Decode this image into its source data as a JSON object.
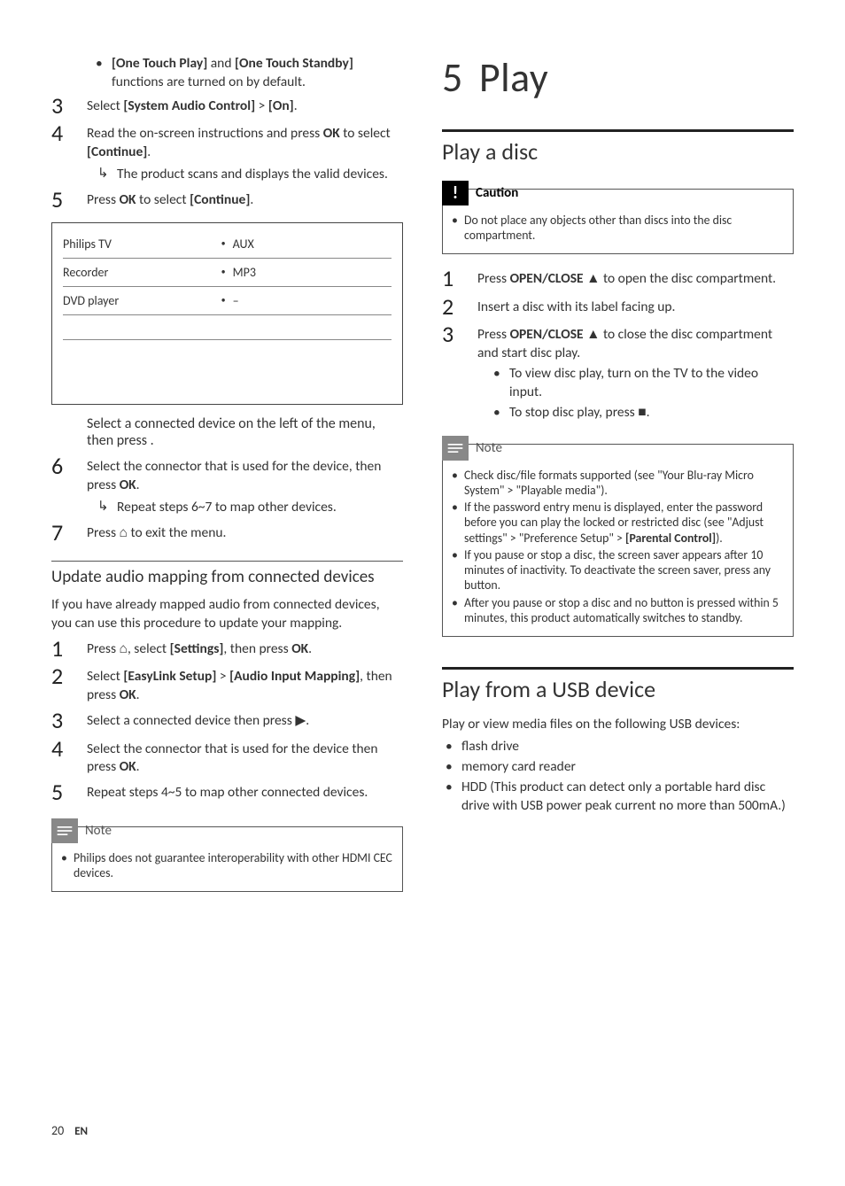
{
  "left": {
    "bullet_default": "[One Touch Play] and [One Touch Standby] functions are turned on by default.",
    "steps_a": [
      {
        "num": "3",
        "text": "Select [System Audio Control] > [On]."
      },
      {
        "num": "4",
        "text": "Read the on-screen instructions and press OK to select [Continue].",
        "sub": "The product scans and displays the valid devices."
      },
      {
        "num": "5",
        "text": "Press OK to select [Continue]."
      }
    ],
    "table": [
      {
        "c1": "Philips TV",
        "c2": "AUX"
      },
      {
        "c1": "Recorder",
        "c2": "MP3"
      },
      {
        "c1": "DVD player",
        "c2": "–"
      },
      {
        "c1": "",
        "c2": ""
      },
      {
        "c1": "",
        "c2": ""
      }
    ],
    "steps_b_intro": "Select a connected device on the left of the menu, then press .",
    "steps_b": [
      {
        "num": "6",
        "text": "Select the connector that is used for the device, then press OK.",
        "sub": "Repeat steps 6~7 to map other devices."
      },
      {
        "num": "7",
        "text": "Press ⌂ to exit the menu."
      }
    ],
    "sub_heading": "Update audio mapping from connected devices",
    "sub_para": "If you have already mapped audio from connected devices, you can use this procedure to update your mapping.",
    "steps_c": [
      {
        "num": "1",
        "text": "Press ⌂, select [Settings], then press OK."
      },
      {
        "num": "2",
        "text": "Select [EasyLink Setup] > [Audio Input Mapping], then press OK."
      },
      {
        "num": "3",
        "text": "Select a connected device then press ▶."
      },
      {
        "num": "4",
        "text": "Select the connector that is used for the device then press OK."
      },
      {
        "num": "5",
        "text": "Repeat steps 4~5 to map other connected devices."
      }
    ],
    "note_label": "Note",
    "note_text": "Philips does not guarantee interoperability with other HDMI CEC devices."
  },
  "right": {
    "chapter_num": "5",
    "chapter_title": "Play",
    "section1": "Play a disc",
    "caution_label": "Caution",
    "caution_text": "Do not place any objects other than discs into the disc compartment.",
    "steps_d": [
      {
        "num": "1",
        "text": "Press OPEN/CLOSE ▲ to open the disc compartment."
      },
      {
        "num": "2",
        "text": "Insert a disc with its label facing up."
      },
      {
        "num": "3",
        "text": "Press OPEN/CLOSE ▲ to close the disc compartment and start disc play.",
        "bullets": [
          "To view disc play, turn on the TV to the video input.",
          "To stop disc play, press ■."
        ]
      }
    ],
    "note_label": "Note",
    "note_items": [
      "Check disc/file formats supported (see \"Your Blu-ray Micro System\" > \"Playable media\").",
      "If the password entry menu is displayed, enter the password before you can play the locked or restricted disc (see \"Adjust settings\" > \"Preference Setup\" > [Parental Control]).",
      "If you pause or stop a disc, the screen saver appears after 10 minutes of inactivity. To deactivate the screen saver, press any button.",
      "After you pause or stop a disc and no button is pressed within 5 minutes, this product automatically switches to standby."
    ],
    "section2": "Play from a USB device",
    "section2_para": "Play or view media files on the following USB devices:",
    "section2_bullets": [
      "flash drive",
      "memory card reader",
      "HDD (This product can detect only a portable hard disc drive with USB power peak current no more than 500mA.)"
    ]
  },
  "footer": {
    "page": "20",
    "lang": "EN"
  }
}
